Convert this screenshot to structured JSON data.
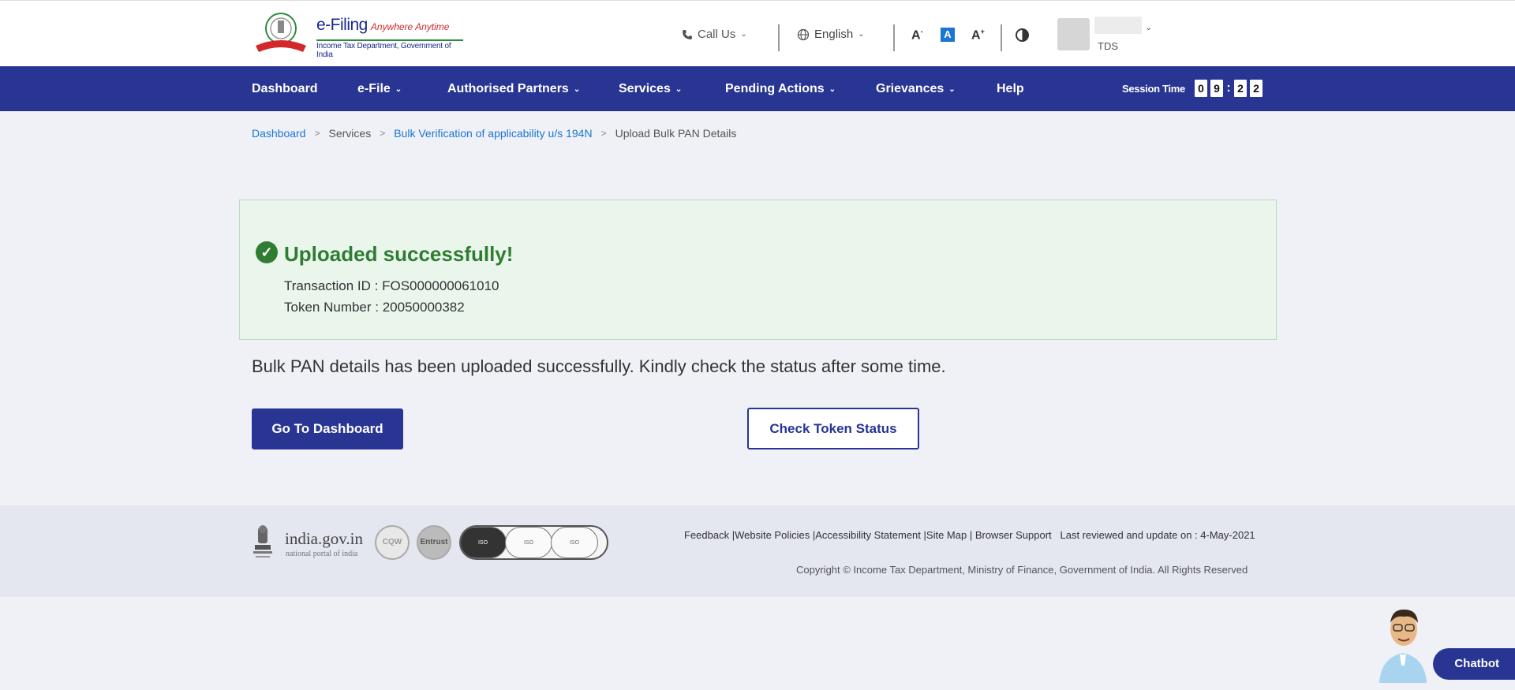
{
  "header": {
    "brand_name": "e-Filing",
    "brand_tagline": "Anywhere Anytime",
    "brand_subtitle": "Income Tax Department, Government of India",
    "call_us": "Call Us",
    "language": "English",
    "font_decrease": "A",
    "font_default": "A",
    "font_increase": "A",
    "user_role": "TDS"
  },
  "nav": {
    "items": [
      {
        "label": "Dashboard"
      },
      {
        "label": "e-File"
      },
      {
        "label": "Authorised Partners"
      },
      {
        "label": "Services"
      },
      {
        "label": "Pending Actions"
      },
      {
        "label": "Grievances"
      },
      {
        "label": "Help"
      }
    ],
    "session_label": "Session Time",
    "session_digits": [
      "0",
      "9",
      "2",
      "2"
    ],
    "session_colon": ":"
  },
  "breadcrumb": {
    "items": [
      "Dashboard",
      "Services",
      "Bulk Verification of applicability u/s 194N",
      "Upload Bulk PAN Details"
    ],
    "separator": ">"
  },
  "success": {
    "title": "Uploaded successfully!",
    "transaction_id": "Transaction ID : FOS000000061010",
    "token_number": "Token Number : 20050000382"
  },
  "message": "Bulk PAN details has been uploaded successfully. Kindly check the status after some time.",
  "buttons": {
    "go_dashboard": "Go To Dashboard",
    "check_token": "Check Token Status"
  },
  "footer": {
    "india_gov": "india.gov.in",
    "india_gov_sub": "national portal of india",
    "links": [
      "Feedback",
      "Website Policies",
      "Accessibility Statement",
      "Site Map",
      "Browser Support"
    ],
    "last_reviewed": "Last reviewed and update on : 4-May-2021",
    "copyright": "Copyright © Income Tax Department, Ministry of Finance, Government of India. All Rights Reserved",
    "seal_cqw": "CQW",
    "seal_entrust": "Entrust"
  },
  "chatbot": {
    "label": "Chatbot"
  },
  "colors": {
    "nav_bg": "#283593",
    "success_green": "#2e7d32",
    "success_bg": "#eaf5ec",
    "link_blue": "#1976d2"
  },
  "icons": [
    "phone-icon",
    "globe-icon",
    "chevron-down-icon",
    "contrast-icon",
    "check-circle-icon",
    "emblem-icon"
  ]
}
